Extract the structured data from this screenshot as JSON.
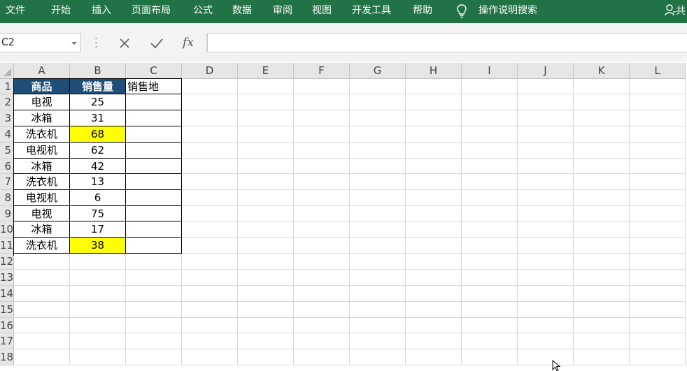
{
  "ribbon": {
    "tabs": [
      "文件",
      "开始",
      "插入",
      "页面布局",
      "公式",
      "数据",
      "审阅",
      "视图",
      "开发工具",
      "帮助"
    ],
    "tell_me": "操作说明搜索",
    "share": "共",
    "bg": "#217346"
  },
  "formula_bar": {
    "name_box": "C2",
    "fx_label": "fx",
    "formula": ""
  },
  "sheet": {
    "columns": [
      "A",
      "B",
      "C",
      "D",
      "E",
      "F",
      "G",
      "H",
      "I",
      "J",
      "K",
      "L"
    ],
    "rows": [
      "1",
      "2",
      "3",
      "4",
      "5",
      "6",
      "7",
      "8",
      "9",
      "10",
      "11",
      "12",
      "13",
      "14",
      "15",
      "16",
      "17",
      "18"
    ],
    "header_row": [
      "商品",
      "销售量",
      "销售地"
    ],
    "data": [
      {
        "item": "电视",
        "qty": "25",
        "place": "",
        "highlight": false
      },
      {
        "item": "冰箱",
        "qty": "31",
        "place": "",
        "highlight": false
      },
      {
        "item": "洗衣机",
        "qty": "68",
        "place": "",
        "highlight": true
      },
      {
        "item": "电视机",
        "qty": "62",
        "place": "",
        "highlight": false
      },
      {
        "item": "冰箱",
        "qty": "42",
        "place": "",
        "highlight": false
      },
      {
        "item": "洗衣机",
        "qty": "13",
        "place": "",
        "highlight": false
      },
      {
        "item": "电视机",
        "qty": "6",
        "place": "",
        "highlight": false
      },
      {
        "item": "电视",
        "qty": "75",
        "place": "",
        "highlight": false
      },
      {
        "item": "冰箱",
        "qty": "17",
        "place": "",
        "highlight": false
      },
      {
        "item": "洗衣机",
        "qty": "38",
        "place": "",
        "highlight": true
      }
    ],
    "header_fill": "#1f4e79",
    "highlight_fill": "#ffff00"
  }
}
